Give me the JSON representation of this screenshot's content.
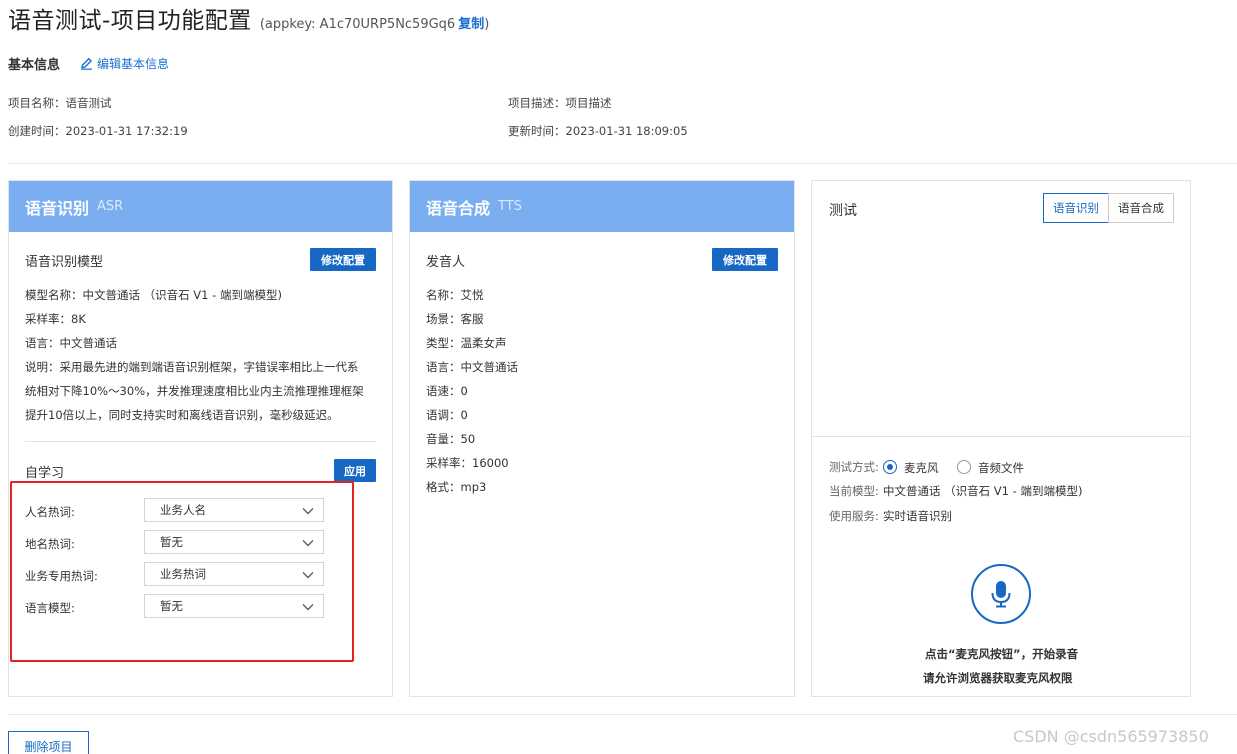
{
  "header": {
    "title": "语音测试-项目功能配置",
    "appkey_prefix": "(appkey: A1c70URP5Nc59Gq6",
    "copy_label": "复制",
    "appkey_suffix": ")"
  },
  "basic": {
    "label": "基本信息",
    "edit_label": "编辑基本信息",
    "name": "项目名称：语音测试",
    "created": "创建时间：2023-01-31 17:32:19",
    "desc": "项目描述：项目描述",
    "updated": "更新时间：2023-01-31 18:09:05"
  },
  "asr": {
    "title": "语音识别",
    "subtitle": "ASR",
    "model_section": "语音识别模型",
    "modify_label": "修改配置",
    "model_name": "模型名称：中文普通话 （识音石 V1 - 端到端模型)",
    "sample_rate": "采样率：8K",
    "language": "语言：中文普通话",
    "desc_lines": [
      "说明：采用最先进的端到端语音识别框架，字错误率相比上一代系",
      "统相对下降10%～30%，并发推理速度相比业内主流推理推理框架",
      "提升10倍以上，同时支持实时和离线语音识别，毫秒级延迟。"
    ],
    "self_learn": "自学习",
    "apply_label": "应用",
    "fields": [
      {
        "label": "人名热词:",
        "value": "业务人名"
      },
      {
        "label": "地名热词:",
        "value": "暂无"
      },
      {
        "label": "业务专用热词:",
        "value": "业务热词"
      },
      {
        "label": "语言模型:",
        "value": "暂无"
      }
    ]
  },
  "tts": {
    "title": "语音合成",
    "subtitle": "TTS",
    "section": "发音人",
    "modify_label": "修改配置",
    "lines": [
      "名称：艾悦",
      "场景：客服",
      "类型：温柔女声",
      "语言：中文普通话",
      "语速：0",
      "语调：0",
      "音量：50",
      "采样率：16000",
      "格式：mp3"
    ]
  },
  "test": {
    "title": "测试",
    "tab_asr": "语音识别",
    "tab_tts": "语音合成",
    "method_label": "测试方式:",
    "option_mic": "麦克风",
    "option_file": "音频文件",
    "model_label": "当前模型:",
    "model_value": "中文普通话 （识音石 V1 - 端到端模型)",
    "service_label": "使用服务:",
    "service_value": "实时语音识别",
    "hint1": "点击“麦克风按钮”，开始录音",
    "hint2": "请允许浏览器获取麦克风权限"
  },
  "footer": {
    "delete_label": "删除项目",
    "watermark": "CSDN @csdn565973850"
  },
  "colors": {
    "accent": "#1668c4",
    "panel_header": "#7aaef0",
    "highlight_box": "#e52222"
  }
}
